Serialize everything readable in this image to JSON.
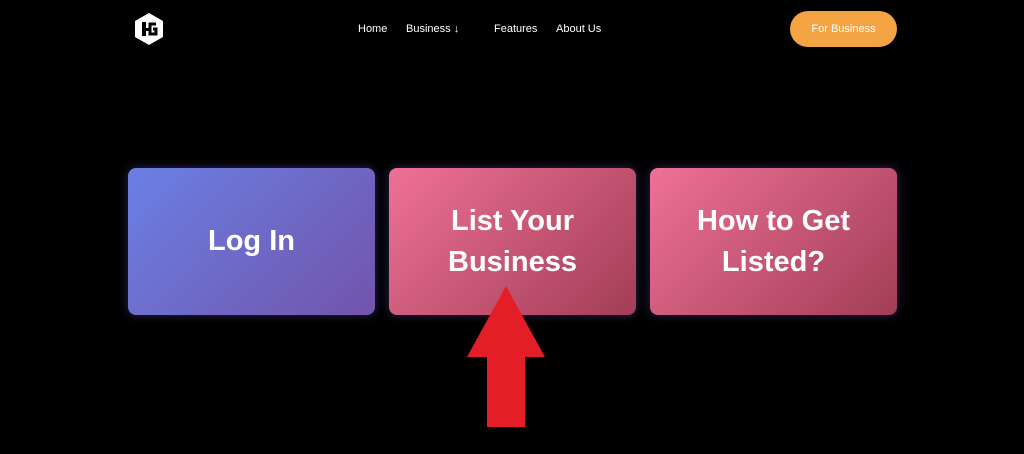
{
  "header": {
    "logo_icon": "hexagon-g-logo",
    "nav": {
      "home": "Home",
      "business": "Business ↓",
      "features": "Features",
      "about": "About Us"
    },
    "cta_label": "For Business"
  },
  "cards": {
    "login": "Log In",
    "list_business_line1": "List Your",
    "list_business_line2": "Business",
    "how_to_line1": "How to Get",
    "how_to_line2": "Listed?"
  },
  "colors": {
    "background": "#000000",
    "cta": "#f4a443",
    "login_gradient": [
      "#6a80e4",
      "#7254ab"
    ],
    "pink_gradient": [
      "#ee7196",
      "#a23e56"
    ],
    "arrow": "#e41e26"
  },
  "annotation": {
    "arrow_icon": "red-up-arrow-icon",
    "points_to": "List Your Business"
  }
}
